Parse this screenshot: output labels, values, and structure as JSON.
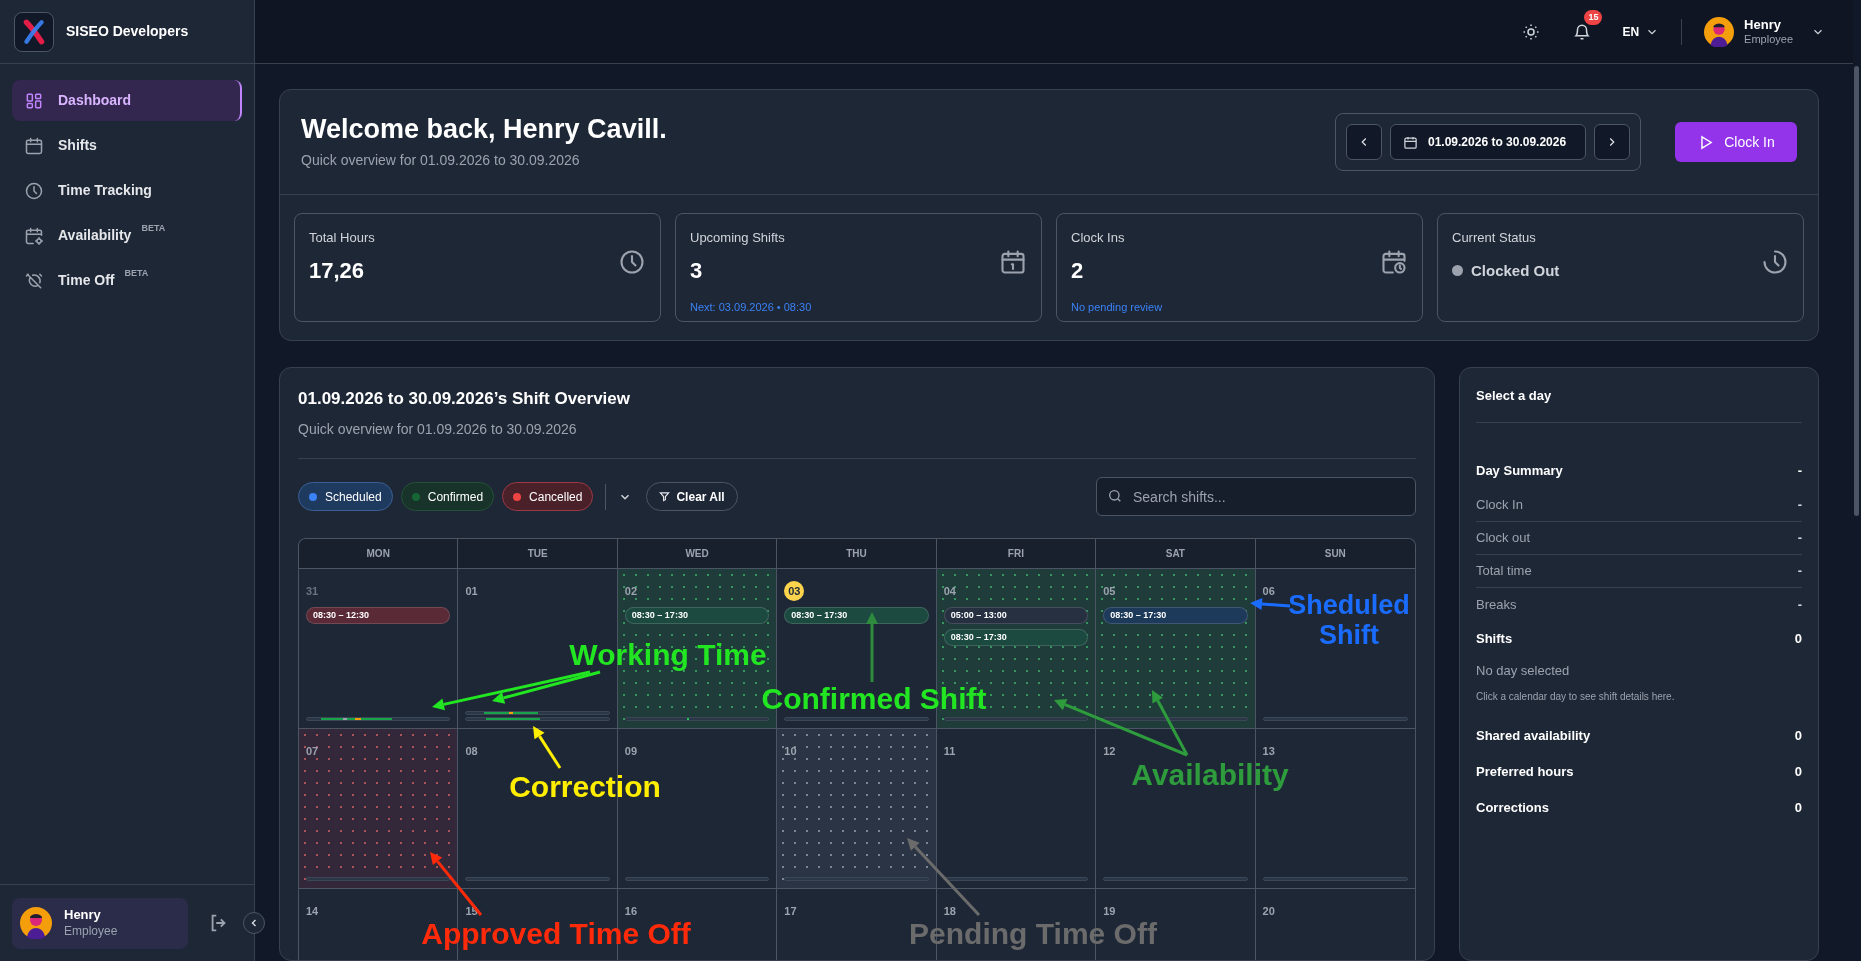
{
  "sidebar": {
    "brand": "SISEO Developers",
    "items": [
      {
        "label": "Dashboard",
        "selected": true
      },
      {
        "label": "Shifts",
        "selected": false
      },
      {
        "label": "Time Tracking",
        "selected": false
      },
      {
        "label": "Availability",
        "badge": "BETA",
        "selected": false
      },
      {
        "label": "Time Off",
        "badge": "BETA",
        "selected": false
      }
    ],
    "user": {
      "name": "Henry",
      "role": "Employee"
    }
  },
  "topbar": {
    "notifications": "15",
    "language": "EN",
    "user": {
      "name": "Henry",
      "role": "Employee"
    }
  },
  "welcome": {
    "title": "Welcome back, Henry Cavill.",
    "subtitle": "Quick overview for 01.09.2026 to 30.09.2026",
    "range": "01.09.2026 to 30.09.2026",
    "clock_in": "Clock In"
  },
  "stats": [
    {
      "label": "Total Hours",
      "value": "17,26"
    },
    {
      "label": "Upcoming Shifts",
      "value": "3",
      "note": "Next: 03.09.2026 • 08:30"
    },
    {
      "label": "Clock Ins",
      "value": "2",
      "note": "No pending review"
    },
    {
      "label": "Current Status",
      "value": "Clocked Out",
      "kind": "status"
    }
  ],
  "overview": {
    "title": "01.09.2026 to 30.09.2026’s Shift Overview",
    "subtitle": "Quick overview for 01.09.2026 to 30.09.2026",
    "filters": [
      {
        "label": "Scheduled",
        "color": "#3b82f6"
      },
      {
        "label": "Confirmed",
        "color": "#166534"
      },
      {
        "label": "Cancelled",
        "color": "#ef4444"
      }
    ],
    "clear": "Clear All",
    "search": {
      "placeholder": "Search shifts..."
    },
    "weekdays": [
      "MON",
      "TUE",
      "WED",
      "THU",
      "FRI",
      "SAT",
      "SUN"
    ],
    "days": [
      {
        "day": "31",
        "muted": true,
        "today": false,
        "kind": "plain",
        "time_bars": [
          {
            "kind": "worked"
          }
        ],
        "shifts": [
          {
            "time": "08:30 – 12:30",
            "color": "#5a2a36"
          }
        ]
      },
      {
        "day": "01",
        "muted": false,
        "today": false,
        "kind": "plain",
        "time_bars": [
          {
            "kind": "corrected"
          },
          {
            "kind": "worked"
          }
        ]
      },
      {
        "day": "02",
        "muted": false,
        "today": false,
        "kind": "availability",
        "time_bars": [
          {
            "kind": "clock_in"
          }
        ],
        "shifts": [
          {
            "time": "08:30 – 17:30",
            "color": "#1d4a40"
          }
        ]
      },
      {
        "day": "03",
        "muted": false,
        "today": true,
        "kind": "plain",
        "time_bars": [
          {
            "kind": "empty"
          }
        ],
        "shifts": [
          {
            "time": "08:30 – 17:30",
            "color": "#1d4a40"
          }
        ]
      },
      {
        "day": "04",
        "muted": false,
        "today": false,
        "kind": "availability",
        "time_bars": [
          {
            "kind": "empty"
          }
        ],
        "shifts": [
          {
            "time": "05:00 – 13:00",
            "color": "#263040"
          },
          {
            "time": "08:30 – 17:30",
            "color": "#1d4a40"
          }
        ]
      },
      {
        "day": "05",
        "muted": false,
        "today": false,
        "kind": "availability",
        "time_bars": [
          {
            "kind": "empty"
          }
        ],
        "shifts": [
          {
            "time": "08:30 – 17:30",
            "color": "#1e3a5a"
          }
        ]
      },
      {
        "day": "06",
        "muted": false,
        "today": false,
        "kind": "plain",
        "time_bars": [
          {
            "kind": "empty"
          }
        ]
      },
      {
        "day": "07",
        "muted": false,
        "today": false,
        "kind": "approved_time_off",
        "time_bars": [
          {
            "kind": "empty"
          }
        ]
      },
      {
        "day": "08",
        "muted": false,
        "today": false,
        "kind": "plain",
        "time_bars": [
          {
            "kind": "empty"
          }
        ]
      },
      {
        "day": "09",
        "muted": false,
        "today": false,
        "kind": "plain",
        "time_bars": [
          {
            "kind": "empty"
          }
        ]
      },
      {
        "day": "10",
        "muted": false,
        "today": false,
        "kind": "pending_time_off",
        "time_bars": [
          {
            "kind": "empty"
          }
        ]
      },
      {
        "day": "11",
        "muted": false,
        "today": false,
        "kind": "plain",
        "time_bars": [
          {
            "kind": "empty"
          }
        ]
      },
      {
        "day": "12",
        "muted": false,
        "today": false,
        "kind": "plain",
        "time_bars": [
          {
            "kind": "empty"
          }
        ]
      },
      {
        "day": "13",
        "muted": false,
        "today": false,
        "kind": "plain",
        "time_bars": [
          {
            "kind": "empty"
          }
        ]
      },
      {
        "day": "14",
        "muted": false,
        "today": false,
        "kind": "plain"
      },
      {
        "day": "15",
        "muted": false,
        "today": false,
        "kind": "plain"
      },
      {
        "day": "16",
        "muted": false,
        "today": false,
        "kind": "plain"
      },
      {
        "day": "17",
        "muted": false,
        "today": false,
        "kind": "plain"
      },
      {
        "day": "18",
        "muted": false,
        "today": false,
        "kind": "plain"
      },
      {
        "day": "19",
        "muted": false,
        "today": false,
        "kind": "plain"
      },
      {
        "day": "20",
        "muted": false,
        "today": false,
        "kind": "plain"
      }
    ]
  },
  "day_panel": {
    "title": "Select a day",
    "rows": [
      {
        "kind": "heading",
        "label": "Day Summary",
        "value": "-"
      },
      {
        "kind": "detail",
        "label": "Clock In",
        "value": "-"
      },
      {
        "kind": "detail",
        "label": "Clock out",
        "value": "-"
      },
      {
        "kind": "detail",
        "label": "Total time",
        "value": "-"
      },
      {
        "kind": "detail",
        "label": "Breaks",
        "value": "-"
      },
      {
        "kind": "heading",
        "label": "Shifts",
        "value": "0"
      },
      {
        "kind": "empty",
        "label": "No day selected",
        "value": "Click a calendar day to see shift details here."
      },
      {
        "kind": "heading",
        "label": "Shared availability",
        "value": "0"
      },
      {
        "kind": "heading",
        "label": "Preferred hours",
        "value": "0"
      },
      {
        "kind": "heading",
        "label": "Corrections",
        "value": "0"
      }
    ]
  },
  "annotations": [
    {
      "text": "Working Time",
      "color": "#22e622"
    },
    {
      "text": "Confirmed Shift",
      "color": "#22e622"
    },
    {
      "text": "Sheduled Shift",
      "color": "#1a6cff"
    },
    {
      "text": "Availability",
      "color": "#2e9b3c"
    },
    {
      "text": "Correction",
      "color": "#ffee00"
    },
    {
      "text": "Approved Time Off",
      "color": "#ff2a0a"
    },
    {
      "text": "Pending Time Off",
      "color": "#6b6b6b"
    }
  ]
}
